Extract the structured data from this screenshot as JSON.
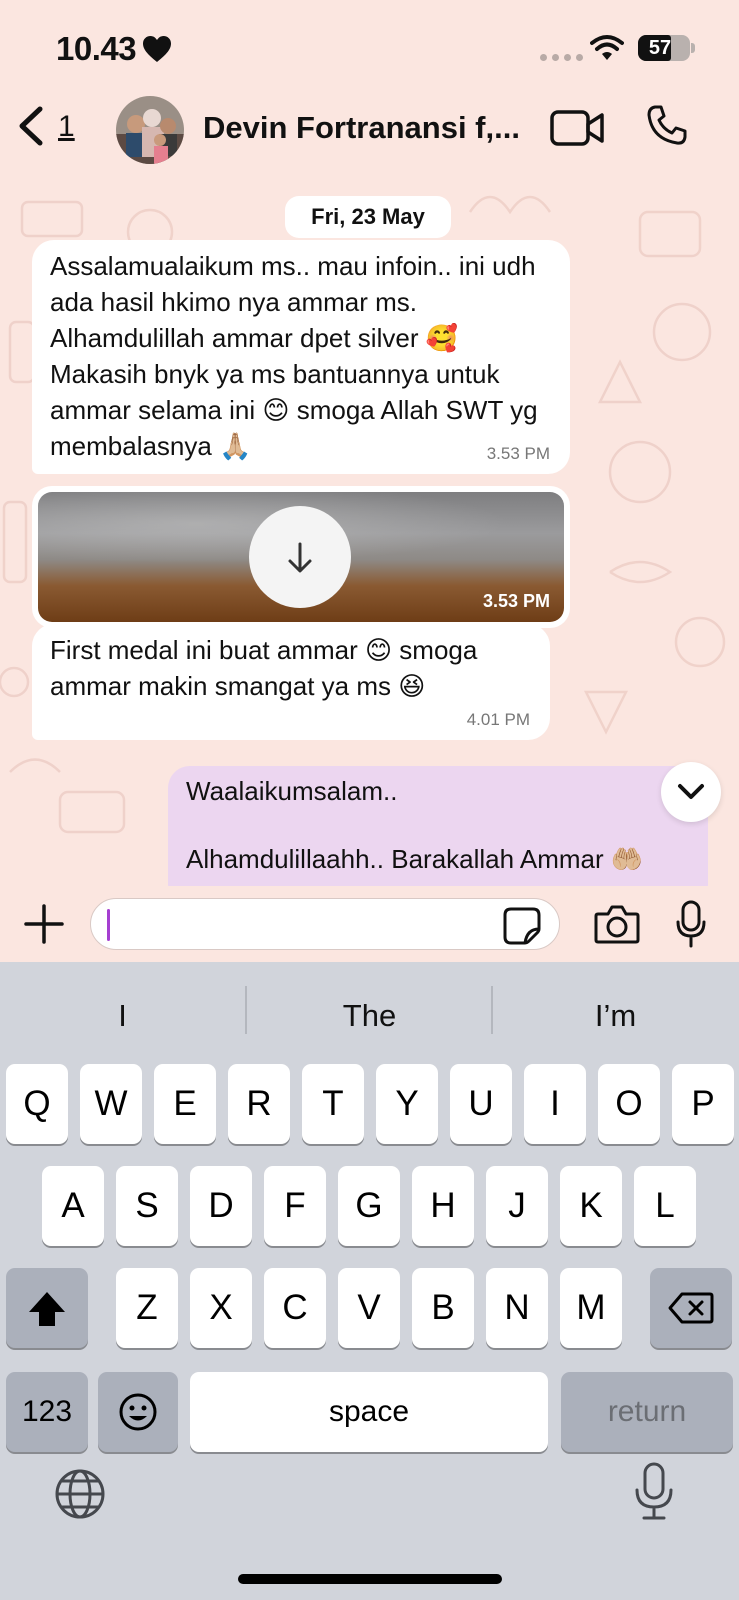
{
  "status": {
    "time": "10.43",
    "battery": "57"
  },
  "header": {
    "unread_count": "1",
    "title": "Devin Fortranansi f,..."
  },
  "chat": {
    "date": "Fri, 23 May",
    "messages": [
      {
        "text": "Assalamualaikum ms.. mau infoin.. ini udh ada hasil hkimo nya ammar ms. Alhamdulillah ammar dpet silver 🥰 Makasih bnyk ya ms bantuannya untuk ammar selama ini 😊 smoga Allah SWT yg membalasnya 🙏🏼",
        "time": "3.53 PM"
      },
      {
        "type": "image",
        "time": "3.53 PM"
      },
      {
        "text": "First medal ini buat ammar 😊 smoga ammar makin smangat ya ms 😆",
        "time": "4.01 PM"
      },
      {
        "text": "Waalaikumsalam..\n\nAlhamdulillaahh.. Barakallah Ammar 🤲🏼",
        "outgoing": true
      }
    ]
  },
  "keyboard": {
    "suggestions": [
      "I",
      "The",
      "I’m"
    ],
    "row1": [
      "Q",
      "W",
      "E",
      "R",
      "T",
      "Y",
      "U",
      "I",
      "O",
      "P"
    ],
    "row2": [
      "A",
      "S",
      "D",
      "F",
      "G",
      "H",
      "J",
      "K",
      "L"
    ],
    "row3": [
      "Z",
      "X",
      "C",
      "V",
      "B",
      "N",
      "M"
    ],
    "numbers": "123",
    "space": "space",
    "return": "return"
  },
  "colors": {
    "background": "#fbe6e0",
    "outgoing_bubble": "#ecd6f0",
    "cursor": "#a53fd1",
    "keyboard": "#d1d4db"
  }
}
